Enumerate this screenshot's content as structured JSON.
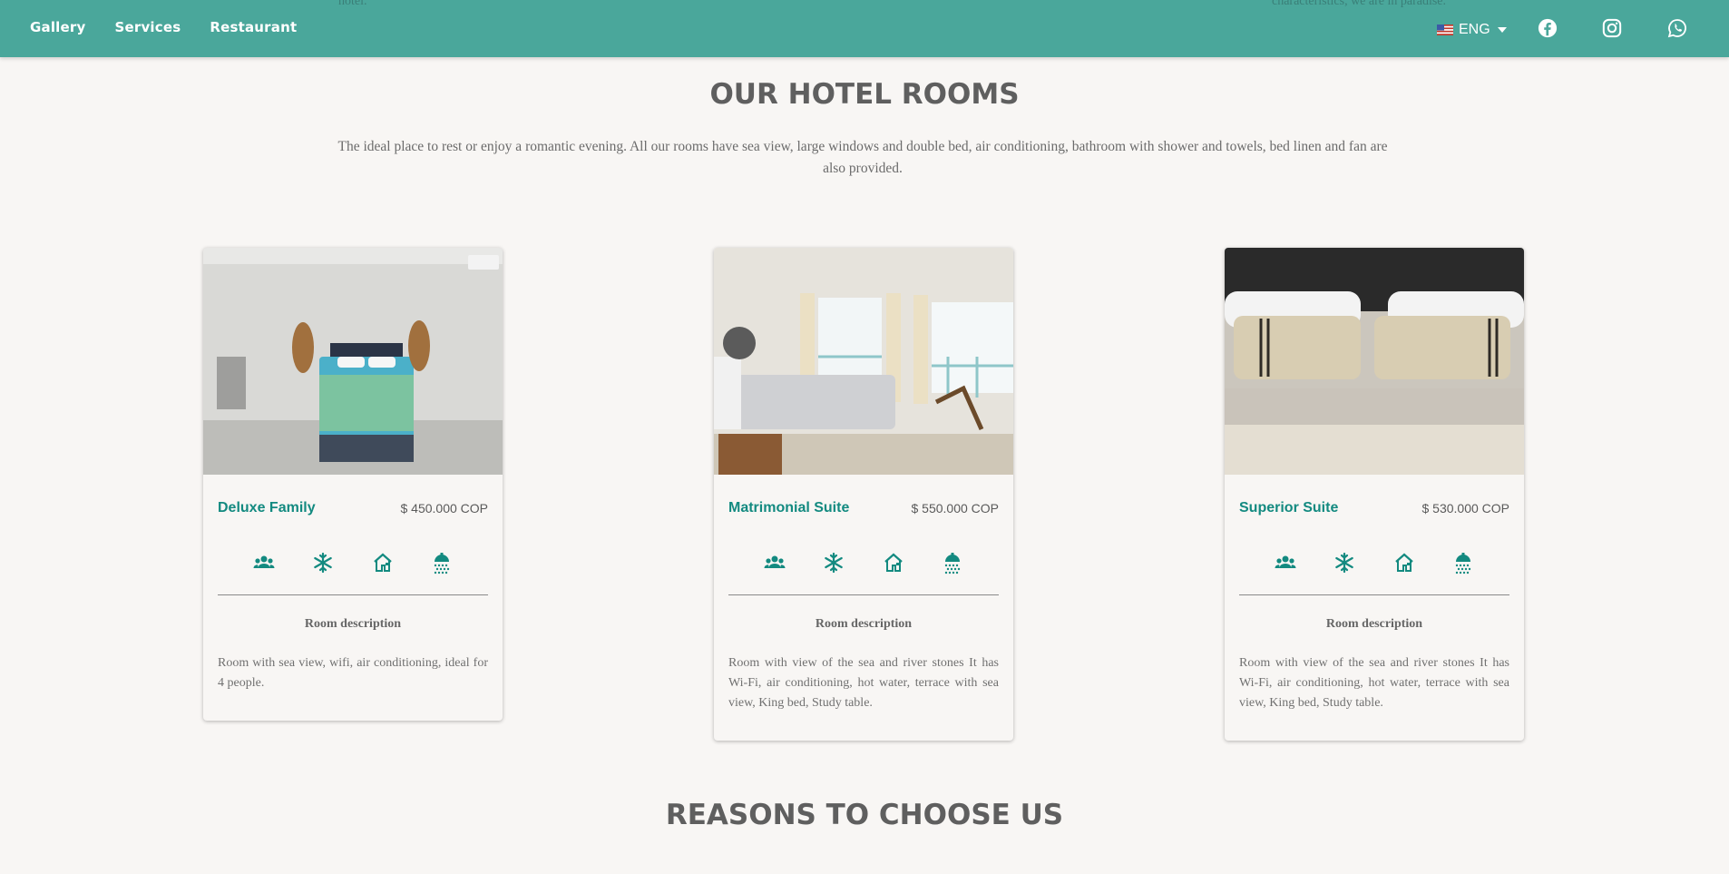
{
  "bleed": {
    "left_text": "hotel.",
    "right_text": "characteristics, we are in paradise."
  },
  "nav": {
    "links": [
      "Gallery",
      "Services",
      "Restaurant"
    ],
    "language": "ENG",
    "social": [
      "facebook-icon",
      "instagram-icon",
      "whatsapp-icon"
    ]
  },
  "rooms_section": {
    "title": "OUR HOTEL ROOMS",
    "intro": "The ideal place to rest or enjoy a romantic evening. All our rooms have sea view, large windows and double bed, air conditioning, bathroom with shower and towels, bed linen and fan are also provided."
  },
  "rooms": [
    {
      "name": "Deluxe Family",
      "price": "$ 450.000 COP",
      "desc_title": "Room description",
      "description": "Room with sea view, wifi, air conditioning, ideal for 4 people."
    },
    {
      "name": "Matrimonial Suite",
      "price": "$ 550.000 COP",
      "desc_title": "Room description",
      "description": "Room with view of the sea and river stones It has Wi-Fi, air conditioning, hot water, terrace with sea view, King bed, Study table."
    },
    {
      "name": "Superior Suite",
      "price": "$ 530.000 COP",
      "desc_title": "Room description",
      "description": "Room with view of the sea and river stones It has Wi-Fi, air conditioning, hot water, terrace with sea view, King bed, Study table."
    }
  ],
  "amenity_icons": [
    "people-icon",
    "snowflake-icon",
    "house-view-icon",
    "shower-icon"
  ],
  "reasons_section": {
    "title": "REASONS TO CHOOSE US"
  },
  "colors": {
    "nav_bg": "#4aa79b",
    "accent": "#138a80",
    "page_bg": "#f8f6f4"
  }
}
